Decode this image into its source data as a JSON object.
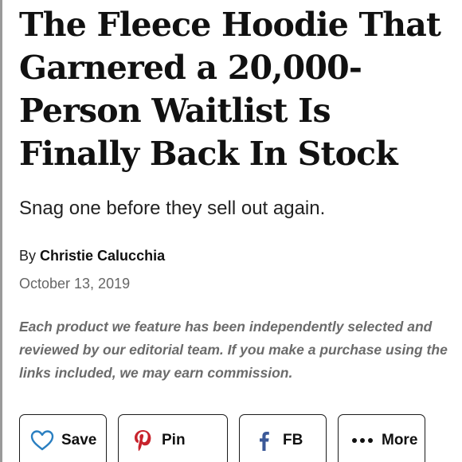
{
  "article": {
    "headline": "The Fleece Hoodie That Garnered a 20,000-Person Waitlist Is Finally Back In Stock",
    "dek": "Snag one before they sell out again.",
    "byline_prefix": "By",
    "author": "Christie Calucchia",
    "date": "October 13, 2019",
    "disclaimer": "Each product we feature has been independently selected and reviewed by our editorial team. If you make a purchase using the links included, we may earn commission."
  },
  "share": {
    "buttons": [
      {
        "label": "Save",
        "icon": "heart-icon",
        "color": "#2a7fc1"
      },
      {
        "label": "Pin",
        "icon": "pinterest-icon",
        "color": "#c8232c"
      },
      {
        "label": "FB",
        "icon": "facebook-icon",
        "color": "#3b5998"
      },
      {
        "label": "More",
        "icon": "ellipsis-icon",
        "color": "#111111"
      }
    ]
  }
}
